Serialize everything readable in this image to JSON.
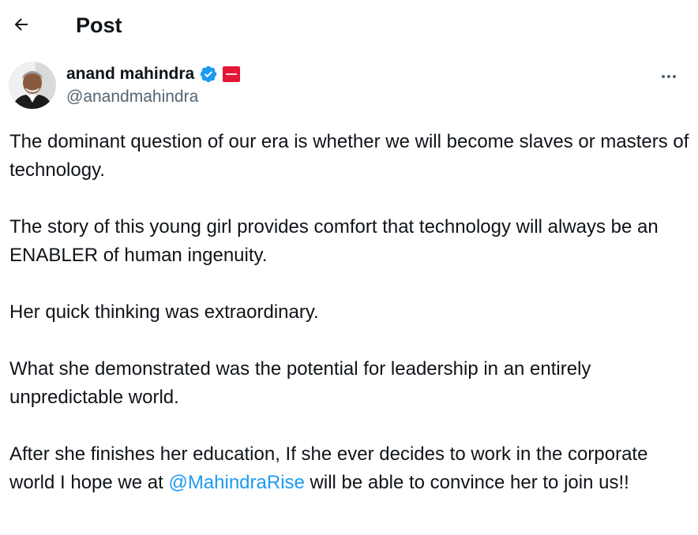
{
  "header": {
    "title": "Post",
    "back_icon": "arrow-left-icon"
  },
  "author": {
    "display_name": "anand mahindra",
    "handle": "@anandmahindra",
    "verified_icon": "verified-badge-icon",
    "affiliate_icon": "mahindra-affiliate-badge-icon",
    "more_icon": "more-options-icon"
  },
  "tweet": {
    "p1": "The dominant question of our era is whether we will become slaves or masters of technology.",
    "p2": "The story of this young girl provides comfort that technology will always be an ENABLER of human ingenuity.",
    "p3": "Her quick thinking was extraordinary.",
    "p4": "What she demonstrated was the potential for leadership in an entirely unpredictable world.",
    "p5_before": "After she finishes her education, If she ever decides to work in the corporate world I hope we at ",
    "p5_mention": "@MahindraRise",
    "p5_after": " will be able to convince her to join us!!"
  },
  "colors": {
    "text": "#0f1419",
    "secondary": "#536471",
    "link": "#1d9bf0",
    "verified": "#1d9bf0",
    "affiliate_red": "#e31837"
  }
}
